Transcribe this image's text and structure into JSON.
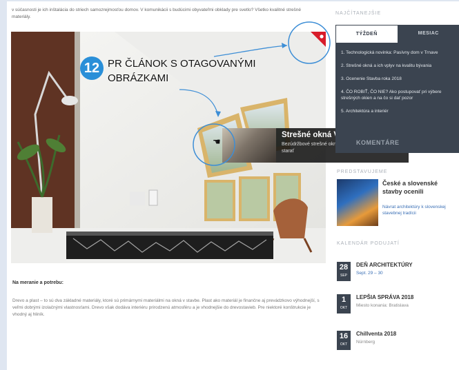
{
  "article": {
    "intro_text": "v súčasnosti je ich inštalácia do striech samozrejmosťou domov. V komunikácii s budúcimi obyvateľmi obklady pre svetlo? Všetko kvalitné strešné materiály.",
    "subheading": "Na meranie a potrebu:",
    "body_text": "Drevo a plast – to sú dva základné materiály, ktoré sú primárnymi materiálmi na okná v stavbe. Plast ako materiál je finančne aj prevádzkovo výhodnejší, s veľmi dobrými izolačnými vlastnosťami. Drevo však dodáva interiéru prirodzenú atmosféru a je vhodnejšie do drevostavieb. Pre niektoré konštrukcie je vhodný aj hliník."
  },
  "callout": {
    "number": "12",
    "text": "PR ČLÁNOK S OTAGOVANÝMI OBRÁZKAMI"
  },
  "tooltip": {
    "title": "Strešné okná VELUX",
    "description": "Bezúdržbové strešné okná – drevo, o ktoré sa netreba starať"
  },
  "sidebar": {
    "widget_title": "NAJČÍTANEJŠIE",
    "tabs": [
      {
        "label": "TÝŽDEŇ",
        "active": true
      },
      {
        "label": "MESIAC",
        "active": false
      }
    ],
    "items": [
      "1. Technologická novinka: Pasívny dom v Trnave",
      "2. Strešné okná a ich vplyv na kvalitu bývania",
      "3. Ocenenie Stavba roka 2018",
      "4. ČO ROBIŤ, ČO NIE? Ako postupovať pri výbere strešných okien a na čo si dať pozor",
      "5. Architektúra a interiér"
    ],
    "comments_button": "KOMENTÁRE",
    "promo_section_title": "PREDSTAVUJEME",
    "promo": {
      "title": "České a slovenské stavby ocenili",
      "text": "Návrat architektúry k slovenskej stavebnej tradícii"
    },
    "calendar_title": "KALENDÁR PODUJATÍ",
    "events": [
      {
        "day": "28",
        "month": "SEP",
        "title": "DEŇ ARCHITEKTÚRY",
        "subtitle": "Sept. 29 – 30",
        "link": true
      },
      {
        "day": "1",
        "month": "OKT",
        "title": "LEPŠIA SPRÁVA 2018",
        "subtitle": "Miesto konania: Bratislava",
        "link": false
      },
      {
        "day": "16",
        "month": "OKT",
        "title": "Chillventa 2018",
        "subtitle": "Nürnberg",
        "link": false
      }
    ]
  },
  "colors": {
    "accent_blue": "#2a8fd8",
    "sidebar_dark": "#3b4450",
    "flag_red": "#d81c2a"
  }
}
